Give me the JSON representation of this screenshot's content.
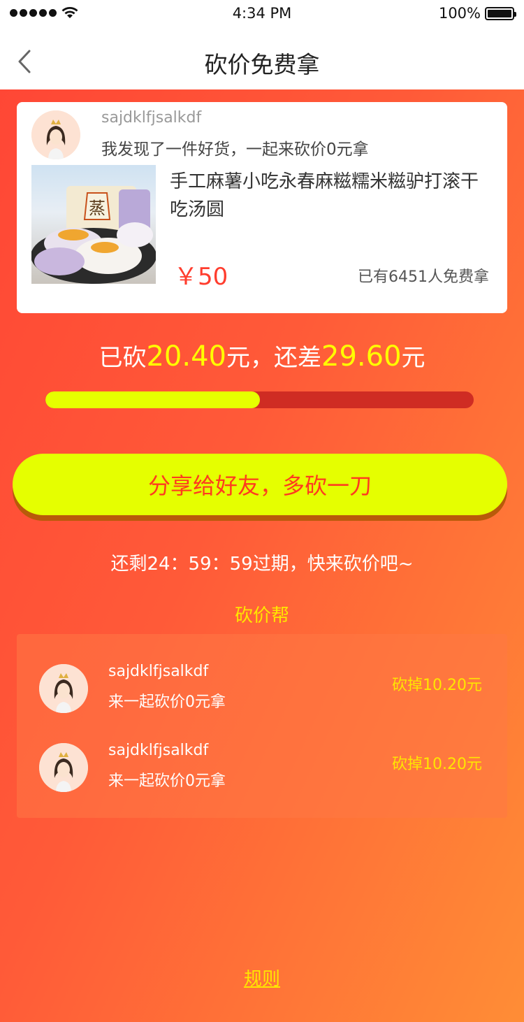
{
  "status_bar": {
    "time": "4:34 PM",
    "battery": "100%",
    "signal_icon": "signal-dots-icon",
    "wifi_icon": "wifi-icon",
    "battery_icon": "battery-icon"
  },
  "nav": {
    "title": "砍价免费拿",
    "back_icon": "chevron-left-icon"
  },
  "product_card": {
    "username": "sajdklfjsalkdf",
    "message": "我发现了一件好货，一起来砍价0元拿",
    "product_title": "手工麻薯小吃永春麻糍糯米糍驴打滚干吃汤圆",
    "image_label": "蒸",
    "price": "￥50",
    "claimed_text": "已有6451人免费拿"
  },
  "bargain": {
    "prefix": "已砍",
    "cut_amount": "20.40",
    "middle": "元，还差",
    "remaining_amount": "29.60",
    "suffix": "元",
    "progress_fraction": 0.5
  },
  "share_button": {
    "label": "分享给好友，多砍一刀"
  },
  "countdown": {
    "text": "还剩24：59：59过期，快来砍价吧~"
  },
  "helpers": {
    "title": "砍价帮",
    "items": [
      {
        "name": "sajdklfjsalkdf",
        "message": "来一起砍价0元拿",
        "amount": "砍掉10.20元"
      },
      {
        "name": "sajdklfjsalkdf",
        "message": "来一起砍价0元拿",
        "amount": "砍掉10.20元"
      }
    ]
  },
  "footer": {
    "rules_label": "规则"
  },
  "colors": {
    "accent_yellow": "#e5ff00",
    "highlight_yellow": "#ffff00",
    "price_red": "#ff3d2e",
    "progress_track": "#cf2c23"
  }
}
